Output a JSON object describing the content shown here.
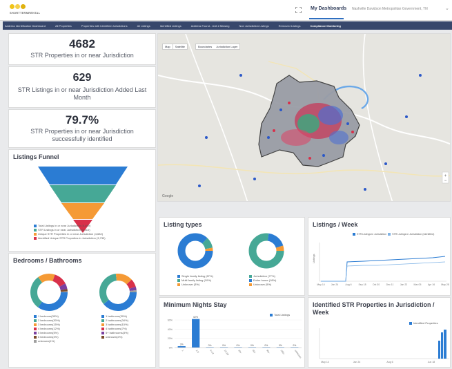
{
  "header": {
    "logo_text": "SHORTTERMRENTAL",
    "my_dashboards": "My Dashboards",
    "dashboard_selector": "Nashville Davidson Metropolitan Government, TN"
  },
  "nav": {
    "items": [
      {
        "label": "Address Identification Dashboard",
        "active": false
      },
      {
        "label": "All Properties",
        "active": false
      },
      {
        "label": "Properties with Identified Jurisdictions",
        "active": false
      },
      {
        "label": "All Listings",
        "active": false
      },
      {
        "label": "Identified Listings",
        "active": false
      },
      {
        "label": "Address Found - Unit # Missing",
        "active": false
      },
      {
        "label": "Non Jurisdiction Listings",
        "active": false
      },
      {
        "label": "Removed Listings",
        "active": false
      },
      {
        "label": "Compliance Monitoring",
        "active": true
      }
    ]
  },
  "stats": {
    "properties": {
      "value": "4682",
      "label": "STR Properties in or near Jurisdiction"
    },
    "listings_added": {
      "value": "629",
      "label": "STR Listings in or near Jurisdiction Added Last Month"
    },
    "identified": {
      "value": "79.7%",
      "label": "STR Properties in or near Jurisdiction successfully identified"
    }
  },
  "map": {
    "controls": [
      "Map",
      "Satellite"
    ],
    "sub_controls": [
      "Boundaries",
      "Jurisdiction Layer"
    ],
    "attribution_left": "Google"
  },
  "funnel": {
    "title": "Listings Funnel",
    "colors": [
      "#2b7cd3",
      "#46a896",
      "#f59a35",
      "#d8304a"
    ],
    "legend": [
      "Total Listings in or near Jurisdiction (5,499)",
      "STR Listings in or near Jurisdiction (5,410)",
      "Unique STR Properties in or near Jurisdiction (4,682)",
      "Identified Unique STR Properties in Jurisdiction (3,733)"
    ]
  },
  "bedrooms": {
    "title": "Bedrooms / Bathrooms",
    "bed_legend": [
      "1 bedroom(35%)",
      "2 bedrooms(30%)",
      "3 bedrooms(15%)",
      "4 bedrooms(12%)",
      "5 bedrooms(5%)",
      "6 bedrooms(2%)",
      "unknown(1%)"
    ],
    "bath_legend": [
      "1 bathroom(39%)",
      "2 bathrooms(34%)",
      "3 bathrooms(15%)",
      "4 bathrooms(7%)",
      "5+ bathrooms(3%)",
      "unknown(2%)"
    ],
    "colors": [
      "#2b7cd3",
      "#46a896",
      "#f59a35",
      "#d8304a",
      "#7b3fa0",
      "#7a4a2a",
      "#a0a0a0"
    ]
  },
  "listing_types": {
    "title": "Listing types",
    "left_legend": [
      "Single family listing (87%)",
      "Multi family listing (10%)",
      "Unknown (3%)"
    ],
    "right_legend": [
      "Jurisdiction (77%)",
      "Entire home (18%)",
      "Unknown (5%)"
    ],
    "colors": [
      "#2b7cd3",
      "#46a896",
      "#f59a35"
    ]
  },
  "listings_week": {
    "title": "Listings / Week",
    "legend": [
      "STR Listings in Jurisdiction",
      "STR Listings in Jurisdiction (Identified)"
    ],
    "y_label": "Listings",
    "x_ticks": [
      "May 14",
      "Jun 24",
      "Aug 6",
      "Sep 18",
      "Oct 30",
      "Dec 11",
      "Jan 22",
      "Mar 05",
      "Apr 16",
      "May 28"
    ]
  },
  "min_nights": {
    "title": "Minimum Nights Stay",
    "legend": "Total Listings",
    "y_ticks": [
      "60%",
      "40%",
      "20%",
      "0%"
    ],
    "categories": [
      "1",
      "2-5",
      "6-14",
      "15-29",
      "30+",
      "60+",
      "90+",
      "180+",
      "unknown"
    ],
    "values": [
      3,
      62,
      0.5,
      0.5,
      0.5,
      0.5,
      0.5,
      0.5,
      0.5
    ],
    "value_labels": [
      "3%",
      "62%",
      "0%",
      "0%",
      "0%",
      "0%",
      "0%",
      "0%",
      "0%"
    ]
  },
  "identified_week": {
    "title": "Identified STR Properties in Jurisdiction / Week",
    "legend": "Identified Properties",
    "x_ticks": [
      "May 14",
      "Jun 24",
      "Aug 6",
      "Jun 18"
    ]
  }
}
